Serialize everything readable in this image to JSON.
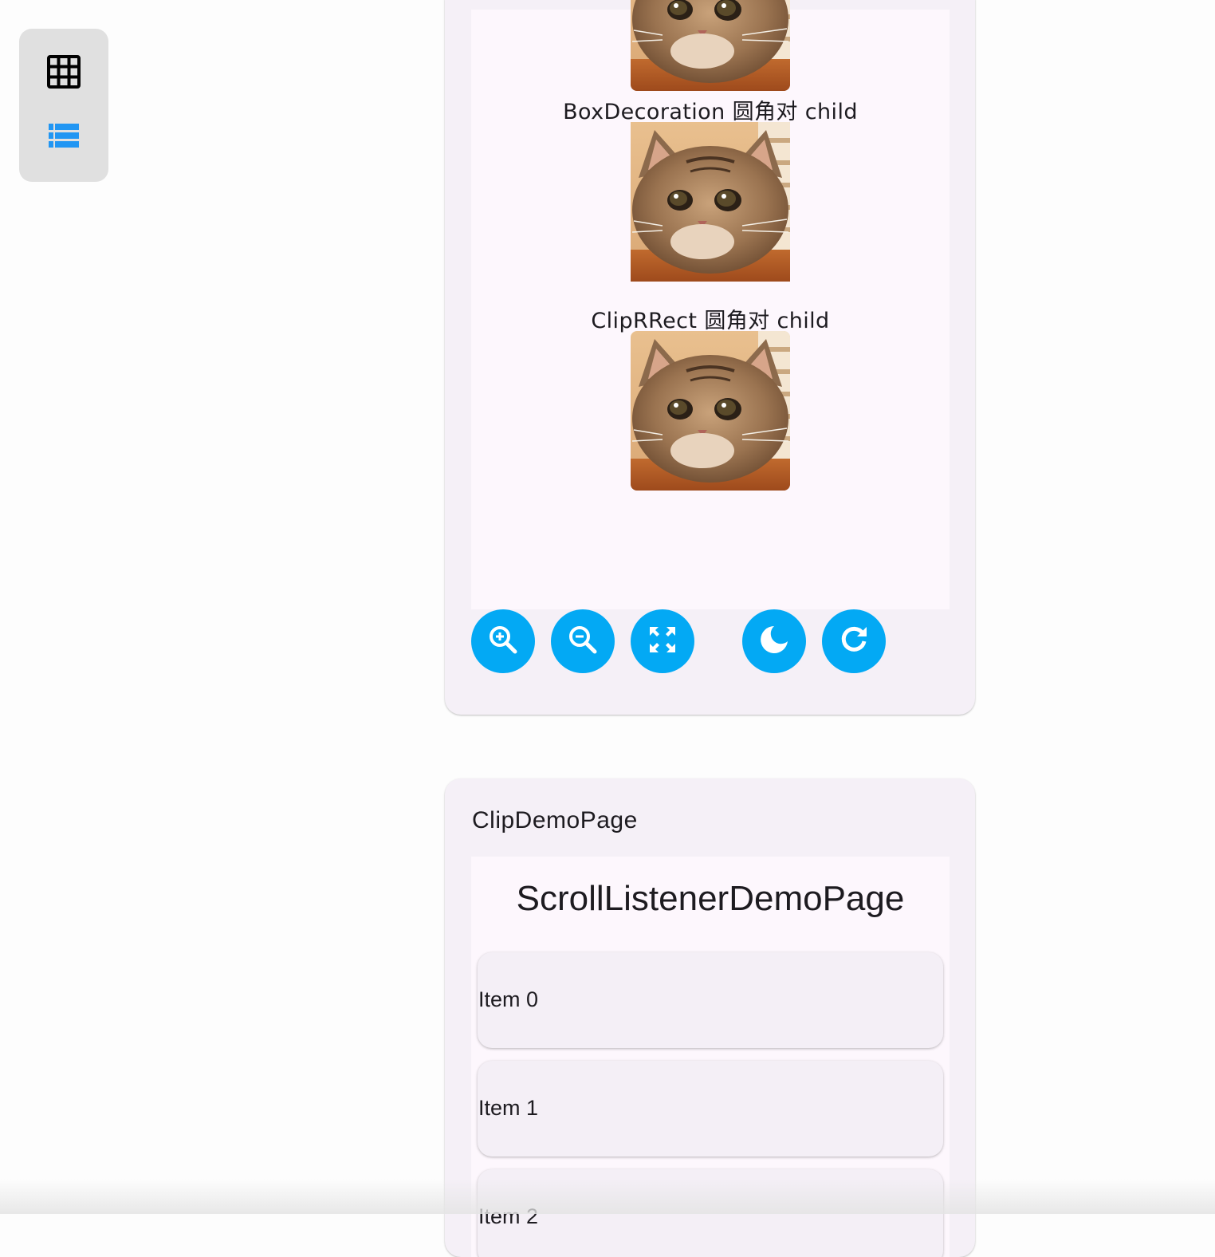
{
  "switcher": {
    "grid_icon": "grid-view-icon",
    "list_icon": "list-view-icon",
    "active_color": "#2196f3"
  },
  "demo_card": {
    "captions": {
      "box_decoration": "BoxDecoration 圆角对 child",
      "clip_rrect": "ClipRRect 圆角对 child"
    },
    "toolbar": [
      {
        "icon": "zoom-in-icon"
      },
      {
        "icon": "zoom-out-icon"
      },
      {
        "icon": "fullscreen-icon"
      },
      {
        "icon": "dark-mode-icon"
      },
      {
        "icon": "refresh-icon"
      }
    ],
    "accent_color": "#03a9f4"
  },
  "clip_card": {
    "title": "ClipDemoPage",
    "heading": "ScrollListenerDemoPage",
    "items": [
      "Item 0",
      "Item 1",
      "Item 2"
    ]
  }
}
